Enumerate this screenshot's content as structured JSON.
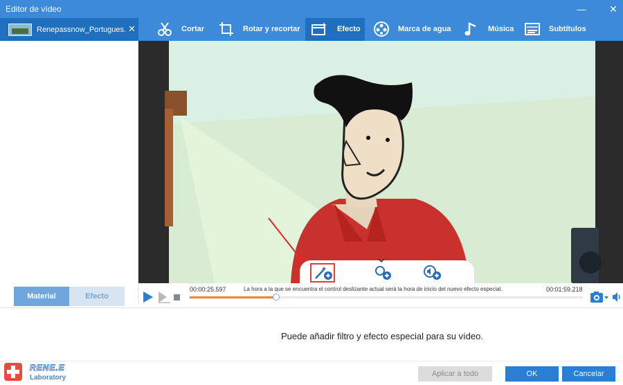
{
  "window": {
    "title": "Editor de vídeo",
    "minimize": "—",
    "close": "✕"
  },
  "file_tab": {
    "name": "Renepassnow_Portugues...",
    "close": "✕"
  },
  "toolbar": {
    "items": [
      {
        "label": "Cortar",
        "icon": "cut-icon"
      },
      {
        "label": "Rotar y recortar",
        "icon": "crop-icon"
      },
      {
        "label": "Efecto",
        "icon": "effect-icon",
        "active": true
      },
      {
        "label": "Marca de agua",
        "icon": "watermark-icon"
      },
      {
        "label": "Música",
        "icon": "music-icon"
      },
      {
        "label": "Subtítulos",
        "icon": "subtitles-icon"
      }
    ]
  },
  "left_tabs": {
    "material": "Material",
    "efecto_especial": "Efecto especial"
  },
  "timeline": {
    "current_time": "00:00:25.597",
    "message": "La hora a la que se encuentra el control deslizante actual será la hora de inicio del nuevo efecto especial.",
    "end_time": "00:01:59.218",
    "progress": 0.22
  },
  "hint": "Puede añadir filtro y efecto especial para su vídeo.",
  "footer": {
    "logo_name": "RENE.E",
    "logo_sub": "Laboratory",
    "apply_all": "Aplicar a todo",
    "ok": "OK",
    "cancel": "Cancelar"
  },
  "colors": {
    "titlebar": "#3c8ad8",
    "active_tab": "#1f6fbe",
    "progress": "#f0862b",
    "highlight": "#e23b3b"
  }
}
